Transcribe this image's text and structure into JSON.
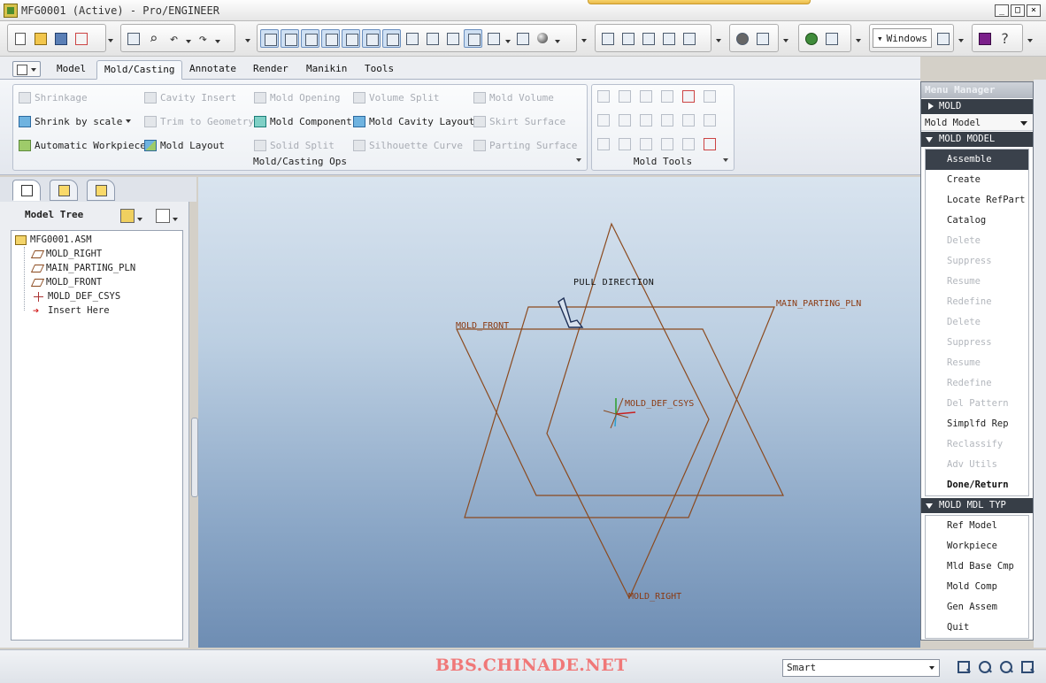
{
  "window": {
    "title": "MFG0001 (Active) - Pro/ENGINEER",
    "windows_label": "Windows"
  },
  "ribbon_tabs": [
    {
      "label": "Model"
    },
    {
      "label": "Mold/Casting"
    },
    {
      "label": "Annotate"
    },
    {
      "label": "Render"
    },
    {
      "label": "Manikin"
    },
    {
      "label": "Tools"
    }
  ],
  "ribbon": {
    "ops_group_label": "Mold/Casting Ops",
    "tools_group_label": "Mold Tools",
    "col1": [
      "Shrinkage",
      "Shrink by scale",
      "Automatic Workpiece"
    ],
    "col2": [
      "Cavity Insert",
      "Trim to Geometry",
      "Mold Layout"
    ],
    "col3": [
      "Mold Opening",
      "Mold Component",
      "Solid Split"
    ],
    "col4": [
      "Volume Split",
      "Mold Cavity Layout",
      "Silhouette Curve"
    ],
    "col5": [
      "Mold Volume",
      "Skirt Surface",
      "Parting Surface"
    ]
  },
  "model_tree": {
    "title": "Model Tree",
    "root": "MFG0001.ASM",
    "items": [
      "MOLD_RIGHT",
      "MAIN_PARTING_PLN",
      "MOLD_FRONT",
      "MOLD_DEF_CSYS",
      "Insert Here"
    ]
  },
  "graphics": {
    "pull_direction": "PULL DIRECTION",
    "labels": {
      "main_parting": "MAIN_PARTING_PLN",
      "mold_front": "MOLD_FRONT",
      "mold_def_csys": "MOLD_DEF_CSYS",
      "mold_right": "MOLD_RIGHT"
    }
  },
  "menu_manager": {
    "title": "Menu Manager",
    "mold_header": "MOLD",
    "mold_select": "Mold Model",
    "mold_model_header": "MOLD MODEL",
    "mold_model_items": [
      "Assemble",
      "Create",
      "Locate RefPart",
      "Catalog",
      "Delete",
      "Suppress",
      "Resume",
      "Redefine",
      "Delete",
      "Suppress",
      "Resume",
      "Redefine",
      "Del Pattern",
      "Simplfd Rep",
      "Reclassify",
      "Adv Utils",
      "Done/Return"
    ],
    "mold_mdl_typ_header": "MOLD MDL TYP",
    "mold_mdl_typ_items": [
      "Ref Model",
      "Workpiece",
      "Mld Base Cmp",
      "Mold Comp",
      "Gen Assem",
      "Quit"
    ]
  },
  "status": {
    "watermark": "BBS.CHINADE.NET",
    "filter_value": "Smart"
  },
  "colors": {
    "datum_plane": "#8b4a1f",
    "menu_active": "#3a414b",
    "watermark": "#f07878"
  }
}
